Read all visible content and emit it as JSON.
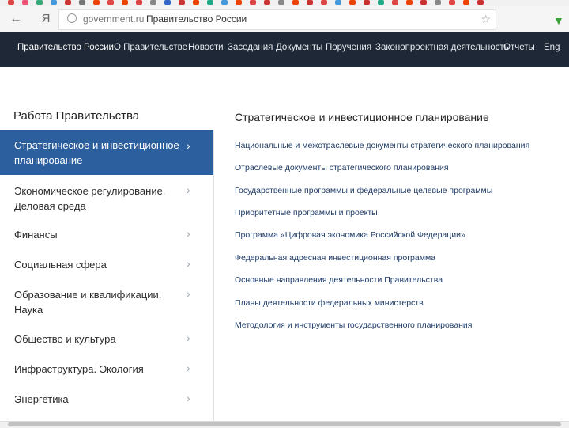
{
  "browser": {
    "url": "government.ru",
    "tab_title": "Правительство России",
    "back_glyph": "←",
    "yandex_glyph": "Я"
  },
  "topnav": {
    "brand": "Правительство России",
    "items": [
      "О Правительстве",
      "Новости",
      "Заседания",
      "Документы",
      "Поручения",
      "Законопроектная деятельность",
      "Отчеты",
      "Eng"
    ]
  },
  "sidebar": {
    "title": "Работа Правительства",
    "items": [
      {
        "label": "Стратегическое и инвестиционное планирование",
        "active": true
      },
      {
        "label": "Экономическое регулирование. Деловая среда",
        "active": false
      },
      {
        "label": "Финансы",
        "active": false
      },
      {
        "label": "Социальная сфера",
        "active": false
      },
      {
        "label": "Образование и квалификации. Наука",
        "active": false
      },
      {
        "label": "Общество и культура",
        "active": false
      },
      {
        "label": "Инфраструктура. Экология",
        "active": false
      },
      {
        "label": "Энергетика",
        "active": false
      }
    ]
  },
  "main": {
    "title": "Стратегическое и инвестиционное планирование",
    "links": [
      "Национальные и межотраслевые документы стратегического планирования",
      "Отраслевые документы стратегического планирования",
      "Государственные программы и федеральные целевые программы",
      "Приоритетные программы и проекты",
      "Программа «Цифровая экономика Российской Федерации»",
      "Федеральная адресная инвестиционная программа",
      "Основные направления деятельности Правительства",
      "Планы деятельности федеральных министерств",
      "Методология и инструменты государственного планирования"
    ]
  },
  "icons": {
    "chevron": "chevron-right-icon",
    "star": "star-icon",
    "menu": "menu-icon"
  },
  "colors": {
    "nav_bg": "#1f2836",
    "active_bg": "#2c5f9e",
    "link": "#1f3c67"
  }
}
